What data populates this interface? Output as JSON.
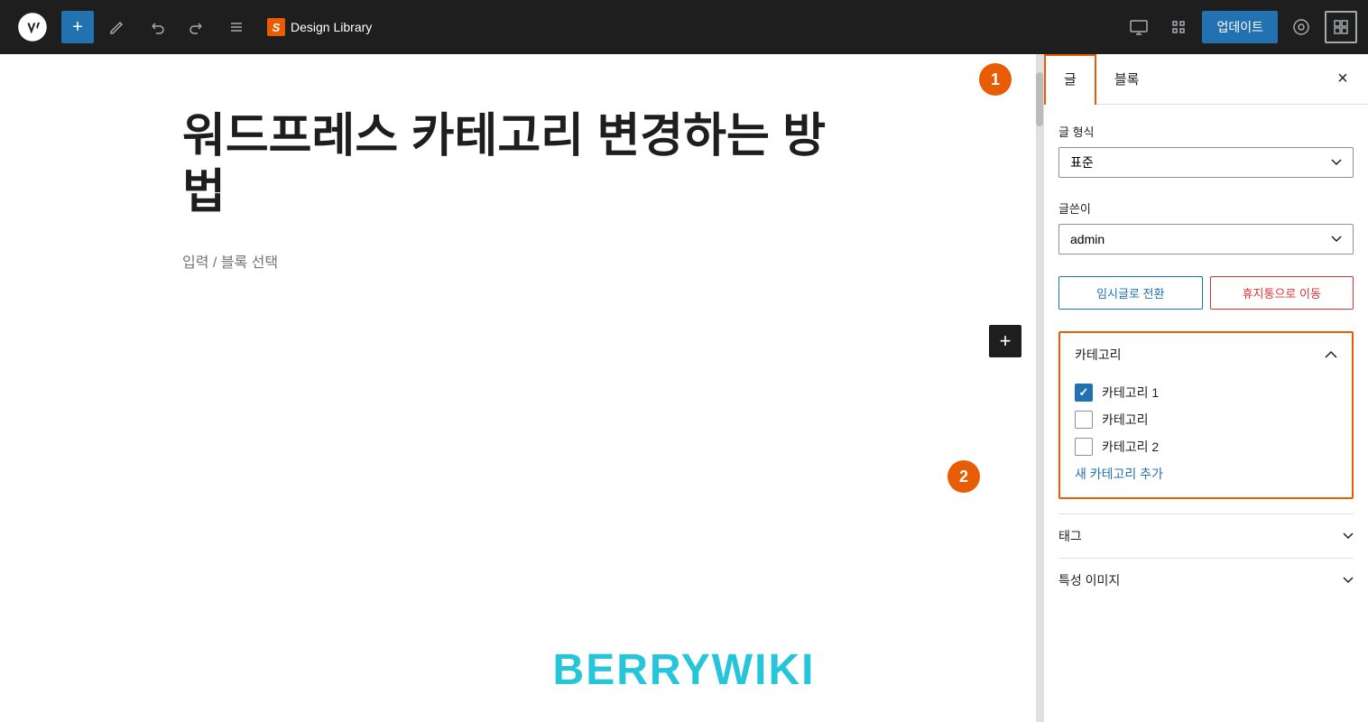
{
  "toolbar": {
    "add_label": "+",
    "design_library": "Design Library",
    "update_label": "업데이트"
  },
  "sidebar": {
    "tab_post": "글",
    "tab_block": "블록",
    "close_label": "×",
    "post_format_label": "글 형식",
    "post_format_value": "표준",
    "author_label": "글쓴이",
    "author_value": "admin",
    "convert_btn": "임시글로 전환",
    "trash_btn": "휴지통으로 이동",
    "category_label": "카테고리",
    "categories": [
      {
        "name": "카테고리 1",
        "checked": true
      },
      {
        "name": "카테고리",
        "checked": false
      },
      {
        "name": "카테고리 2",
        "checked": false
      }
    ],
    "add_category": "새 카테고리 추가",
    "tags_label": "태그",
    "featured_image_label": "특성 이미지"
  },
  "editor": {
    "title": "워드프레스 카테고리 변경하는 방법",
    "placeholder": "입력 / 블록 선택"
  },
  "steps": {
    "step1": "1",
    "step2": "2"
  }
}
